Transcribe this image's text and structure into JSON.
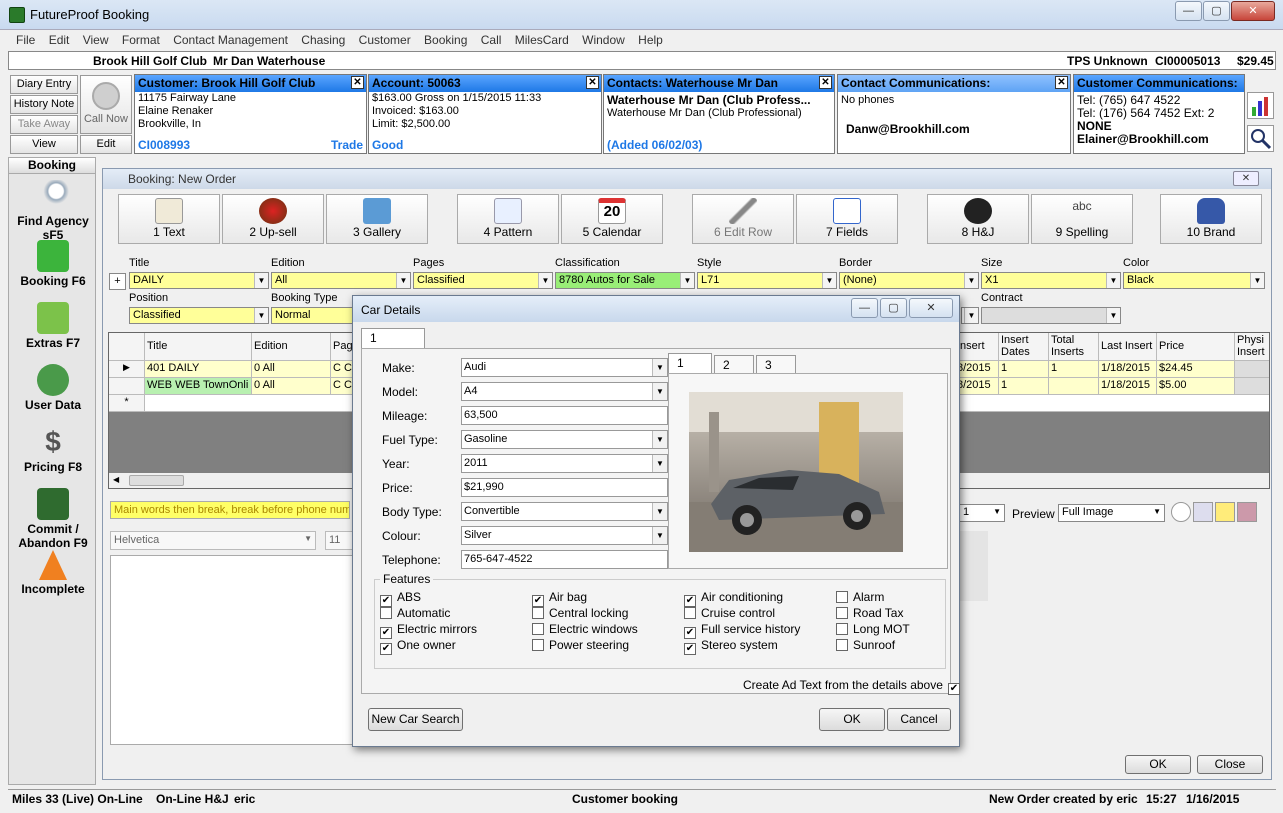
{
  "app": {
    "title": "FutureProof Booking",
    "min": "—",
    "max": "▢",
    "close": "✕"
  },
  "menu": [
    "File",
    "Edit",
    "View",
    "Format",
    "Contact Management",
    "Chasing",
    "Customer",
    "Booking",
    "Call",
    "MilesCard",
    "Window",
    "Help"
  ],
  "custbar": {
    "customer": "Brook Hill Golf Club",
    "contact": "Mr Dan Waterhouse",
    "tps": "TPS Unknown",
    "code": "CI00005013",
    "amount": "$29.45"
  },
  "left_buttons": [
    "Diary Entry",
    "History Note",
    "Take Away",
    "View"
  ],
  "call_now": "Call Now",
  "edit": "Edit",
  "panels": {
    "customer": {
      "title": "Customer: Brook Hill Golf Club",
      "lines": [
        "11175 Fairway Lane",
        "Elaine Renaker",
        "Brookville, In"
      ],
      "footer": "CI008993",
      "footer_right": "Trade"
    },
    "account": {
      "title": "Account: 50063",
      "lines": [
        "$163.00 Gross on 1/15/2015 11:33",
        "Invoiced: $163.00",
        "Limit: $2,500.00"
      ],
      "footer": "Good"
    },
    "contacts": {
      "title": "Contacts: Waterhouse Mr Dan",
      "lines": [
        "Waterhouse Mr Dan (Club Profess...",
        "Waterhouse Mr Dan (Club Professional)"
      ],
      "footer": "(Added 06/02/03)"
    },
    "contact_comm": {
      "title": "Contact Communications:",
      "lines": [
        "No phones",
        "Danw@Brookhill.com"
      ]
    },
    "customer_comm": {
      "title": "Customer Communications:",
      "lines": [
        "Tel:    (765) 647 4522",
        "Tel:    (176) 564 7452 Ext: 2",
        "NONE",
        "Elainer@Brookhill.com"
      ]
    }
  },
  "nav": {
    "header": "Booking",
    "items": [
      "Find Agency sF5",
      "Booking F6",
      "Extras F7",
      "User Data",
      "Pricing F8",
      "Commit / Abandon F9",
      "Incomplete"
    ]
  },
  "booking": {
    "title": "Booking: New Order",
    "toolbar": [
      "1 Text",
      "2 Up-sell",
      "3 Gallery",
      "4 Pattern",
      "5 Calendar",
      "6 Edit Row",
      "7 Fields",
      "8 H&J",
      "9 Spelling",
      "10 Brand"
    ],
    "calendar_day": "20",
    "fields": {
      "title_l": "Title",
      "title": "DAILY",
      "edition_l": "Edition",
      "edition": "All",
      "pages_l": "Pages",
      "pages": "Classified",
      "class_l": "Classification",
      "class": "8780 Autos for Sale",
      "style_l": "Style",
      "style": "L71",
      "border_l": "Border",
      "border": "(None)",
      "size_l": "Size",
      "size": "X1",
      "color_l": "Color",
      "color": "Black",
      "position_l": "Position",
      "position": "Classified",
      "btype_l": "Booking Type",
      "btype": "Normal",
      "contract_l": "Contract"
    },
    "grid": {
      "headers": [
        "Title",
        "Edition",
        "Pag",
        "Insert",
        "Insert Dates",
        "Total Inserts",
        "Last Insert",
        "Price",
        "Physi Insert"
      ],
      "rows": [
        [
          "401 DAILY",
          "0 All",
          "C C",
          "8/2015",
          "1",
          "1",
          "1/18/2015",
          "$24.45"
        ],
        [
          "WEB WEB TownOnli",
          "0 All",
          "C C",
          "8/2015",
          "1",
          "",
          "1/18/2015",
          "$5.00"
        ]
      ]
    },
    "hint": "Main words then break, break before phone numb",
    "font": "Helvetica",
    "fontsize": "11",
    "preview_l": "Preview",
    "preview": "Full Image",
    "small_combo": "1",
    "ok": "OK",
    "close": "Close"
  },
  "dialog": {
    "title": "Car Details",
    "tab": "1",
    "image_tabs": [
      "1",
      "2",
      "3"
    ],
    "fields": [
      {
        "l": "Make:",
        "v": "Audi",
        "dd": true
      },
      {
        "l": "Model:",
        "v": "A4",
        "dd": true
      },
      {
        "l": "Mileage:",
        "v": "63,500",
        "dd": false
      },
      {
        "l": "Fuel Type:",
        "v": "Gasoline",
        "dd": true
      },
      {
        "l": "Year:",
        "v": "2011",
        "dd": true
      },
      {
        "l": "Price:",
        "v": "$21,990",
        "dd": false
      },
      {
        "l": "Body Type:",
        "v": "Convertible",
        "dd": true
      },
      {
        "l": "Colour:",
        "v": "Silver",
        "dd": true
      },
      {
        "l": "Telephone:",
        "v": "765-647-4522",
        "dd": false
      }
    ],
    "features_l": "Features",
    "features": [
      [
        "ABS",
        true
      ],
      [
        "Automatic",
        false
      ],
      [
        "Electric mirrors",
        true
      ],
      [
        "One owner",
        true
      ],
      [
        "Air bag",
        true
      ],
      [
        "Central locking",
        false
      ],
      [
        "Electric windows",
        false
      ],
      [
        "Power steering",
        false
      ],
      [
        "Air conditioning",
        true
      ],
      [
        "Cruise control",
        false
      ],
      [
        "Full service history",
        true
      ],
      [
        "Stereo system",
        true
      ],
      [
        "Alarm",
        false
      ],
      [
        "Road Tax",
        false
      ],
      [
        "Long MOT",
        false
      ],
      [
        "Sunroof",
        false
      ]
    ],
    "create_ad": "Create Ad Text from the details above",
    "new_search": "New Car Search",
    "ok": "OK",
    "cancel": "Cancel"
  },
  "status": {
    "miles": "Miles 33 (Live) On-Line",
    "hj": "On-Line H&J",
    "user": "eric",
    "center": "Customer booking",
    "right": "New Order created by eric",
    "time": "15:27",
    "date": "1/16/2015"
  }
}
